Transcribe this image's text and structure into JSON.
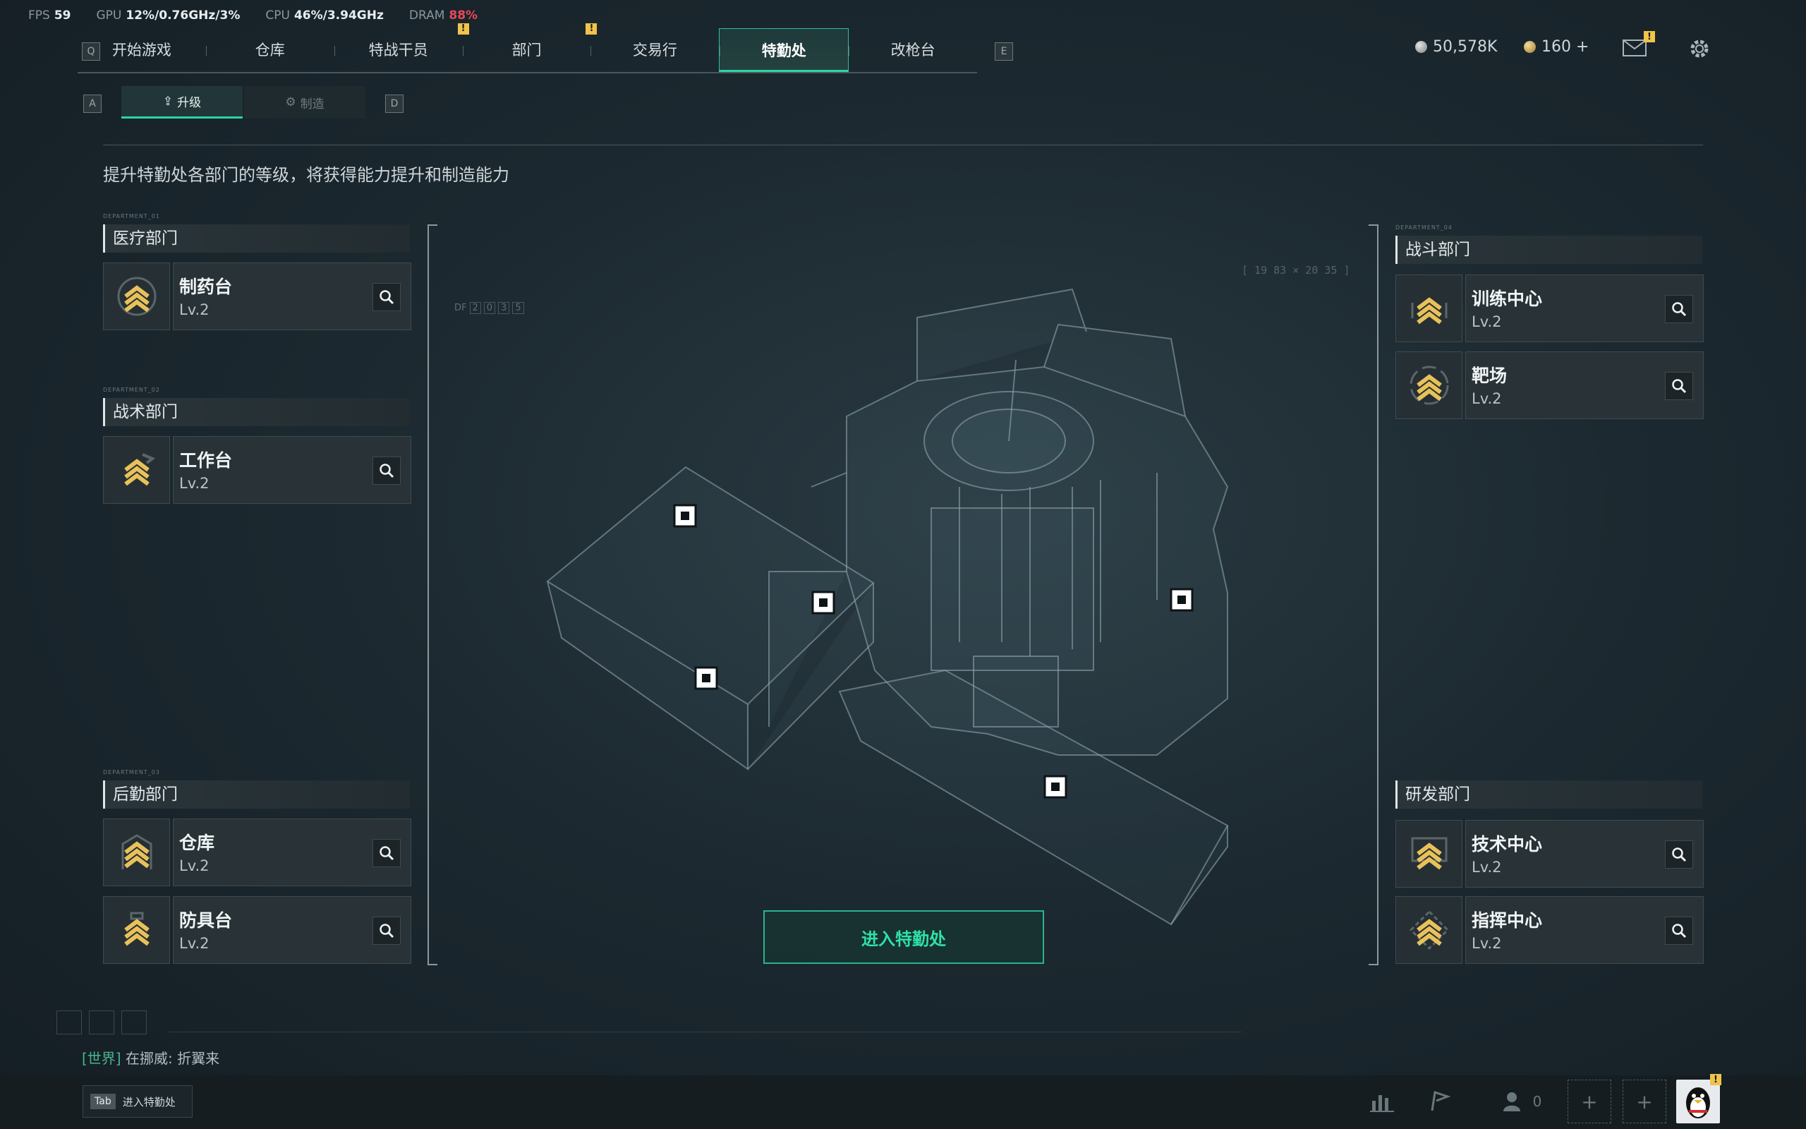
{
  "perf": {
    "fps_label": "FPS",
    "fps": "59",
    "gpu_label": "GPU",
    "gpu": "12%/0.76GHz/3%",
    "cpu_label": "CPU",
    "cpu": "46%/3.94GHz",
    "dram_label": "DRAM",
    "dram": "88%"
  },
  "nav": {
    "prev_key": "Q",
    "next_key": "E",
    "tabs": [
      {
        "label": "开始游戏"
      },
      {
        "label": "仓库"
      },
      {
        "label": "特战干员",
        "badge": "!"
      },
      {
        "label": "部门",
        "badge": "!"
      },
      {
        "label": "交易行"
      },
      {
        "label": "特勤处",
        "active": true
      },
      {
        "label": "改枪台"
      }
    ]
  },
  "currency": {
    "silver": "50,578K",
    "gold": "160 +"
  },
  "mail_badge": "!",
  "subtabs": {
    "prev_key": "A",
    "next_key": "D",
    "upgrade": "升级",
    "craft": "制造"
  },
  "description": "提升特勤处各部门的等级，将获得能力提升和制造能力",
  "departments": {
    "medical": {
      "code": "DEPARTMENT_01",
      "name": "医疗部门",
      "facilities": [
        {
          "name": "制药台",
          "level": "Lv.2"
        }
      ]
    },
    "tactical": {
      "code": "DEPARTMENT_02",
      "name": "战术部门",
      "facilities": [
        {
          "name": "工作台",
          "level": "Lv.2"
        }
      ]
    },
    "logistics": {
      "code": "DEPARTMENT_03",
      "name": "后勤部门",
      "facilities": [
        {
          "name": "仓库",
          "level": "Lv.2"
        },
        {
          "name": "防具台",
          "level": "Lv.2"
        }
      ]
    },
    "combat": {
      "code": "DEPARTMENT_04",
      "name": "战斗部门",
      "facilities": [
        {
          "name": "训练中心",
          "level": "Lv.2"
        },
        {
          "name": "靶场",
          "level": "Lv.2"
        }
      ]
    },
    "research": {
      "name": "研发部门",
      "facilities": [
        {
          "name": "技术中心",
          "level": "Lv.2"
        },
        {
          "name": "指挥中心",
          "level": "Lv.2"
        }
      ]
    }
  },
  "hud_text": {
    "df_label": "DF",
    "df_digits": [
      "2",
      "0",
      "3",
      "5"
    ],
    "coords": "[ 19 83 × 20 35 ]"
  },
  "enter_button": "进入特勤处",
  "chat": {
    "channel": "[世界]",
    "user": "在挪威:",
    "message": "折翼来"
  },
  "bottom": {
    "tab_key": "Tab",
    "tab_label": "进入特勤处",
    "friends_count": "0",
    "avatar_badge": "!"
  },
  "colors": {
    "accent": "#2dd4a3",
    "warning": "#f0c34a",
    "danger": "#e64a5a",
    "chevron": "#e8c15a"
  }
}
